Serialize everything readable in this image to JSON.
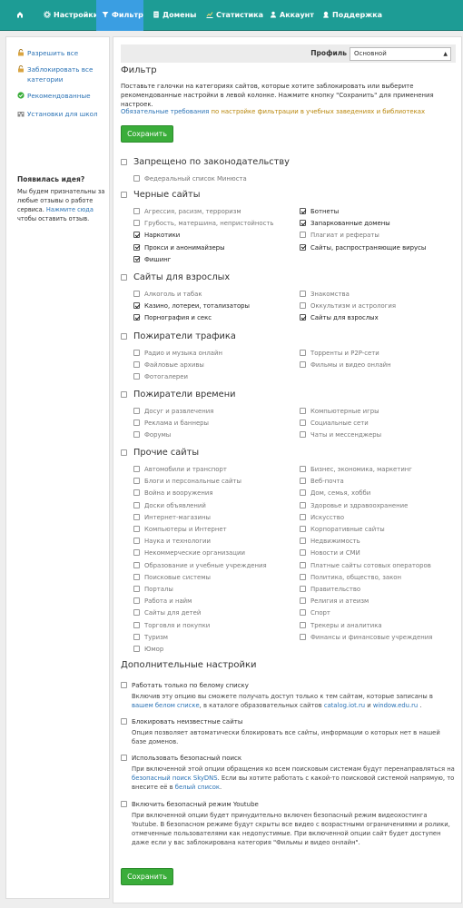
{
  "nav": {
    "items": [
      {
        "label": "",
        "icon": "home-icon"
      },
      {
        "label": "Настройки",
        "icon": "settings-icon"
      },
      {
        "label": "Фильтр",
        "icon": "filter-icon"
      },
      {
        "label": "Домены",
        "icon": "document-icon"
      },
      {
        "label": "Статистика",
        "icon": "chart-icon"
      },
      {
        "label": "Аккаунт",
        "icon": "user-icon"
      },
      {
        "label": "Поддержка",
        "icon": "support-icon"
      }
    ],
    "active": "Фильтр",
    "color": "#1d9c95",
    "active_color": "#3a9ee2"
  },
  "sidebar": {
    "links": [
      {
        "label": "Разрешить все",
        "icon": "lock-icon"
      },
      {
        "label": "Заблокировать все",
        "label2": "категории",
        "icon": "lock-icon"
      },
      {
        "label": "Рекомендованные",
        "icon": "check-icon"
      },
      {
        "label": "Установки для школ",
        "icon": "school-icon"
      }
    ],
    "idea_title": "Появилась идея?",
    "idea_text_1": "Мы будем признательны за любые отзывы о работе сервиса. ",
    "idea_link": "Нажмите сюда",
    "idea_text_2": " чтобы оставить отзыв."
  },
  "profile": {
    "label": "Профиль",
    "value": "Основной"
  },
  "filter": {
    "title": "Фильтр",
    "description": "Поставьте галочки на категориях сайтов, которые хотите заблокировать или выберите рекомендованные настройки в левой колонке. Нажмите кнопку \"Сохранить\" для применения настроек.",
    "req_link": "Обязательные требования",
    "req_text": " по настройке фильтрации в учебных заведениях и библиотеках",
    "save_label": "Сохранить"
  },
  "sections": [
    {
      "title": "Запрещено по законодательству",
      "checked": false,
      "left": [
        {
          "label": "Федеральный список Минюста",
          "checked": false
        }
      ],
      "right": []
    },
    {
      "title": "Черные сайты",
      "checked": false,
      "left": [
        {
          "label": "Агрессия, расизм, терроризм",
          "checked": false
        },
        {
          "label": "Грубость, матершина, непристойность",
          "checked": false
        },
        {
          "label": "Наркотики",
          "checked": true
        },
        {
          "label": "Прокси и анонимайзеры",
          "checked": true
        },
        {
          "label": "Фишинг",
          "checked": true
        }
      ],
      "right": [
        {
          "label": "Ботнеты",
          "checked": true
        },
        {
          "label": "Запаркованные домены",
          "checked": true
        },
        {
          "label": "Плагиат и рефераты",
          "checked": false
        },
        {
          "label": "Сайты, распространяющие вирусы",
          "checked": true
        }
      ]
    },
    {
      "title": "Сайты для взрослых",
      "checked": false,
      "left": [
        {
          "label": "Алкоголь и табак",
          "checked": false
        },
        {
          "label": "Казино, лотереи, тотализаторы",
          "checked": true
        },
        {
          "label": "Порнография и секс",
          "checked": true
        }
      ],
      "right": [
        {
          "label": "Знакомства",
          "checked": false
        },
        {
          "label": "Оккультизм и астрология",
          "checked": false
        },
        {
          "label": "Сайты для взрослых",
          "checked": true
        }
      ]
    },
    {
      "title": "Пожиратели трафика",
      "checked": false,
      "left": [
        {
          "label": "Радио и музыка онлайн",
          "checked": false
        },
        {
          "label": "Файловые архивы",
          "checked": false
        },
        {
          "label": "Фотогалереи",
          "checked": false
        }
      ],
      "right": [
        {
          "label": "Торренты и P2P-сети",
          "checked": false
        },
        {
          "label": "Фильмы и видео онлайн",
          "checked": false
        }
      ]
    },
    {
      "title": "Пожиратели времени",
      "checked": false,
      "left": [
        {
          "label": "Досуг и развлечения",
          "checked": false
        },
        {
          "label": "Реклама и баннеры",
          "checked": false
        },
        {
          "label": "Форумы",
          "checked": false
        }
      ],
      "right": [
        {
          "label": "Компьютерные игры",
          "checked": false
        },
        {
          "label": "Социальные сети",
          "checked": false
        },
        {
          "label": "Чаты и мессенджеры",
          "checked": false
        }
      ]
    },
    {
      "title": "Прочие сайты",
      "checked": false,
      "left": [
        {
          "label": "Автомобили и транспорт",
          "checked": false
        },
        {
          "label": "Блоги и персональные сайты",
          "checked": false
        },
        {
          "label": "Война и вооружения",
          "checked": false
        },
        {
          "label": "Доски объявлений",
          "checked": false
        },
        {
          "label": "Интернет-магазины",
          "checked": false
        },
        {
          "label": "Компьютеры и Интернет",
          "checked": false
        },
        {
          "label": "Наука и технологии",
          "checked": false
        },
        {
          "label": "Некоммерческие организации",
          "checked": false
        },
        {
          "label": "Образование и учебные учреждения",
          "checked": false
        },
        {
          "label": "Поисковые системы",
          "checked": false
        },
        {
          "label": "Порталы",
          "checked": false
        },
        {
          "label": "Работа и найм",
          "checked": false
        },
        {
          "label": "Сайты для детей",
          "checked": false
        },
        {
          "label": "Торговля и покупки",
          "checked": false
        },
        {
          "label": "Туризм",
          "checked": false
        },
        {
          "label": "Юмор",
          "checked": false
        }
      ],
      "right": [
        {
          "label": "Бизнес, экономика, маркетинг",
          "checked": false
        },
        {
          "label": "Веб-почта",
          "checked": false
        },
        {
          "label": "Дом, семья, хобби",
          "checked": false
        },
        {
          "label": "Здоровье и здравоохранение",
          "checked": false
        },
        {
          "label": "Искусство",
          "checked": false
        },
        {
          "label": "Корпоративные сайты",
          "checked": false
        },
        {
          "label": "Недвижимость",
          "checked": false
        },
        {
          "label": "Новости и СМИ",
          "checked": false
        },
        {
          "label": "Платные сайты сотовых операторов",
          "checked": false
        },
        {
          "label": "Политика, общество, закон",
          "checked": false
        },
        {
          "label": "Правительство",
          "checked": false
        },
        {
          "label": "Религия и атеизм",
          "checked": false
        },
        {
          "label": "Спорт",
          "checked": false
        },
        {
          "label": "Трекеры и аналитика",
          "checked": false
        },
        {
          "label": "Финансы и финансовые учреждения",
          "checked": false
        }
      ]
    }
  ],
  "extra": {
    "title": "Дополнительные настройки",
    "options": [
      {
        "label": "Работать только по белому списку",
        "checked": false,
        "desc": [
          {
            "t": "Включив эту опцию вы сможете получать доступ только к тем сайтам, которые записаны в "
          },
          {
            "t": "вашем белом списке",
            "link": true
          },
          {
            "t": ", в каталоге образовательных сайтов "
          },
          {
            "t": "catalog.iot.ru",
            "link": true
          },
          {
            "t": " и "
          },
          {
            "t": "window.edu.ru",
            "link": true
          },
          {
            "t": " ."
          }
        ]
      },
      {
        "label": "Блокировать неизвестные сайты",
        "checked": false,
        "desc": [
          {
            "t": "Опция позволяет автоматически блокировать все сайты, информации о которых нет в нашей базе доменов."
          }
        ]
      },
      {
        "label": "Использовать безопасный поиск",
        "checked": false,
        "desc": [
          {
            "t": "При включенной этой опции обращения ко всем поисковым системам будут перенаправляться на "
          },
          {
            "t": "безопасный поиск SkyDNS",
            "link": true
          },
          {
            "t": ". Если вы хотите работать с какой-то поисковой системой напрямую, то внесите её в "
          },
          {
            "t": "белый список",
            "link": true
          },
          {
            "t": "."
          }
        ]
      },
      {
        "label": "Включить безопасный режим Youtube",
        "checked": false,
        "desc": [
          {
            "t": "При включенной опции будет принудительно включен безопасный режим видеохостинга Youtube. В безопасном режиме будут скрыты все видео с возрастными ограничениями и ролики, отмеченные пользователями как недопустимые. При включенной опции сайт будет доступен даже если у вас заблокирована категория \"Фильмы и видео онлайн\"."
          }
        ]
      }
    ]
  },
  "save_bottom": "Сохранить"
}
